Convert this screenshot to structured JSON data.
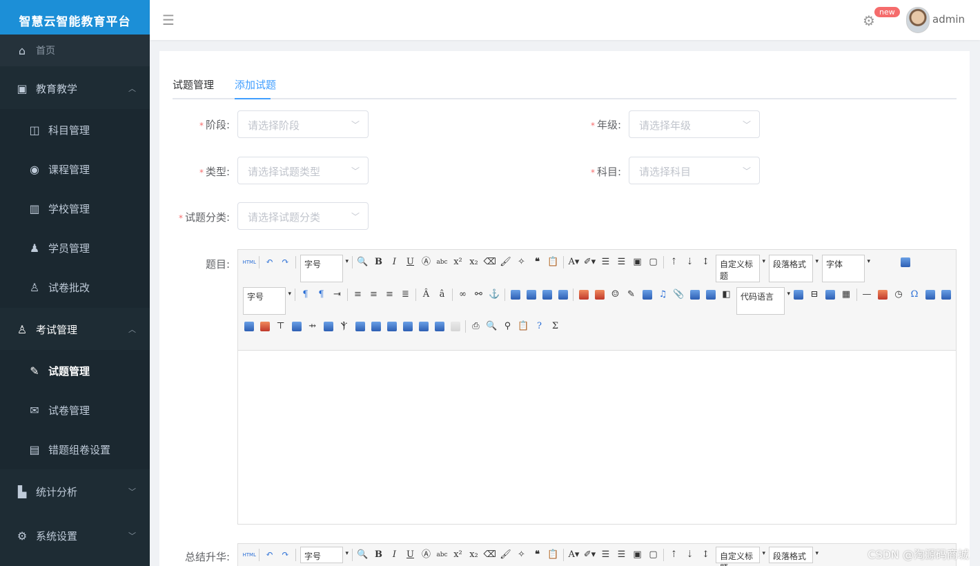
{
  "app": {
    "title": "智慧云智能教育平台"
  },
  "sidebar": {
    "home": "首页",
    "groups": [
      {
        "label": "教育教学",
        "items": [
          "科目管理",
          "课程管理",
          "学校管理",
          "学员管理",
          "试卷批改"
        ]
      },
      {
        "label": "考试管理",
        "items": [
          "试题管理",
          "试卷管理",
          "错题组卷设置"
        ]
      },
      {
        "label": "统计分析"
      },
      {
        "label": "系统设置"
      }
    ]
  },
  "header": {
    "badge": "new",
    "username": "admin"
  },
  "tabs": [
    "试题管理",
    "添加试题"
  ],
  "form": {
    "stage": {
      "label": "阶段:",
      "placeholder": "请选择阶段"
    },
    "grade": {
      "label": "年级:",
      "placeholder": "请选择年级"
    },
    "type": {
      "label": "类型:",
      "placeholder": "请选择试题类型"
    },
    "subject": {
      "label": "科目:",
      "placeholder": "请选择科目"
    },
    "category": {
      "label": "试题分类:",
      "placeholder": "请选择试题分类"
    },
    "question_label": "题目:",
    "summary_label": "总结升华:"
  },
  "editor": {
    "fontsize": "字号",
    "custom_title": "自定义标题",
    "paragraph": "段落格式",
    "font": "字体",
    "code_lang": "代码语言",
    "html": "HTML",
    "bold": "B",
    "italic": "I",
    "underline": "U",
    "sigma": "Σ",
    "omega": "Ω"
  },
  "watermark": "CSDN @淘源码商城"
}
